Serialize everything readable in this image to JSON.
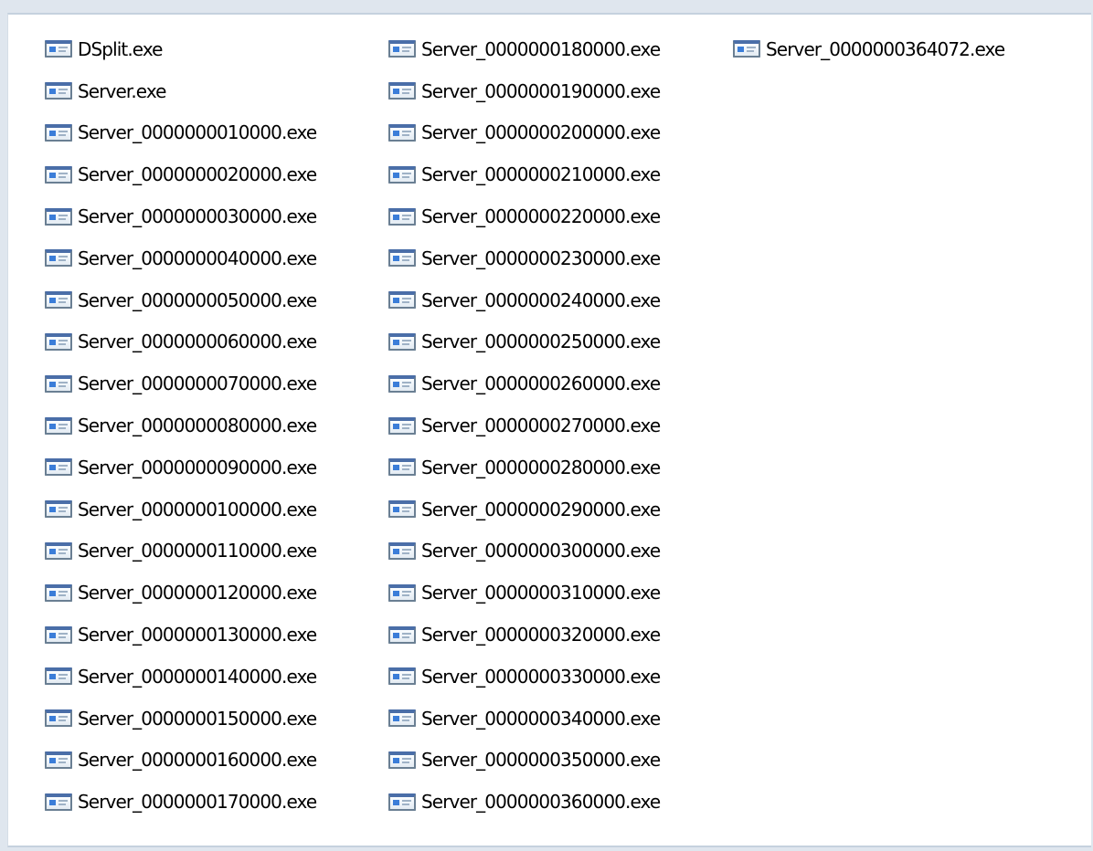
{
  "file_list": {
    "icon": "exe-application-icon",
    "columns": [
      [
        "DSplit.exe",
        "Server.exe",
        "Server_0000000010000.exe",
        "Server_0000000020000.exe",
        "Server_0000000030000.exe",
        "Server_0000000040000.exe",
        "Server_0000000050000.exe",
        "Server_0000000060000.exe",
        "Server_0000000070000.exe",
        "Server_0000000080000.exe",
        "Server_0000000090000.exe",
        "Server_0000000100000.exe",
        "Server_0000000110000.exe",
        "Server_0000000120000.exe",
        "Server_0000000130000.exe",
        "Server_0000000140000.exe",
        "Server_0000000150000.exe",
        "Server_0000000160000.exe",
        "Server_0000000170000.exe"
      ],
      [
        "Server_0000000180000.exe",
        "Server_0000000190000.exe",
        "Server_0000000200000.exe",
        "Server_0000000210000.exe",
        "Server_0000000220000.exe",
        "Server_0000000230000.exe",
        "Server_0000000240000.exe",
        "Server_0000000250000.exe",
        "Server_0000000260000.exe",
        "Server_0000000270000.exe",
        "Server_0000000280000.exe",
        "Server_0000000290000.exe",
        "Server_0000000300000.exe",
        "Server_0000000310000.exe",
        "Server_0000000320000.exe",
        "Server_0000000330000.exe",
        "Server_0000000340000.exe",
        "Server_0000000350000.exe",
        "Server_0000000360000.exe"
      ],
      [
        "Server_0000000364072.exe"
      ]
    ]
  }
}
